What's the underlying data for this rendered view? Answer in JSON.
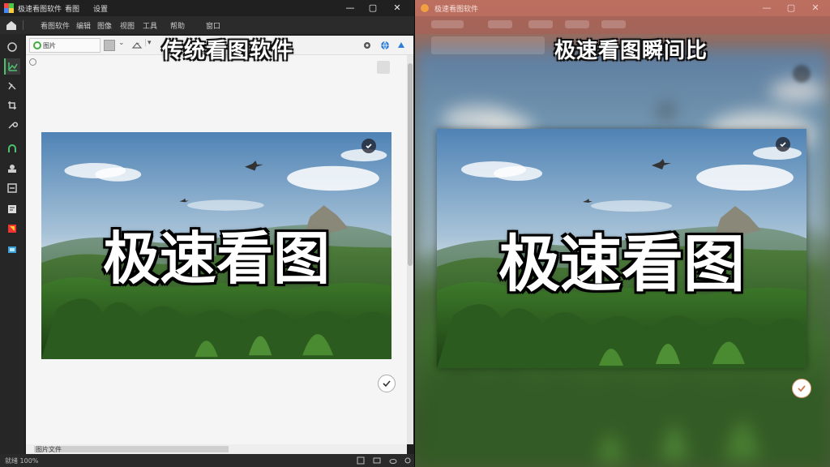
{
  "left": {
    "window_title": "极速看图软件",
    "menu_top": [
      "看图",
      "设置"
    ],
    "menubar": [
      "看图软件",
      "编辑",
      "图像",
      "视图",
      "工具",
      "帮助",
      "窗口"
    ],
    "toolbar": {
      "address": "图片"
    },
    "caption": "传统看图软件",
    "image_text": "极速看图",
    "hscroll_label": "图片文件",
    "status_text": "就绪 100%"
  },
  "right": {
    "window_title": "极速看图软件",
    "caption": "极速看图瞬间比",
    "image_text": "极速看图"
  },
  "icons": {
    "window_min": "minimize-icon",
    "window_max": "maximize-icon",
    "window_close": "close-icon",
    "check": "check-icon"
  },
  "colors": {
    "accent_green": "#4cc26f",
    "right_titlebar": "#be6e5f",
    "check_ring": "#e0a27a"
  }
}
